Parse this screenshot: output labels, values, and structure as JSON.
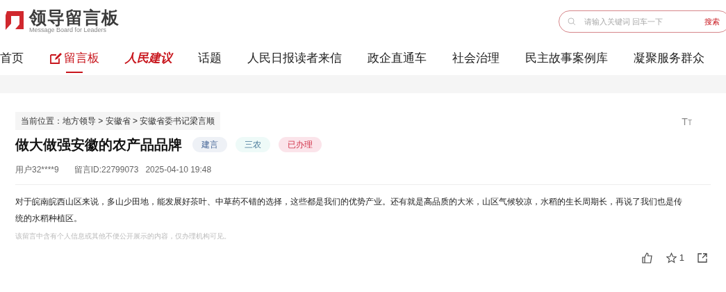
{
  "logo": {
    "title": "领导留言板",
    "subtitle": "Message Board for Leaders"
  },
  "search": {
    "placeholder": "请输入关键词 回车一下",
    "button": "搜索"
  },
  "nav": [
    {
      "label": "首页",
      "kind": "plain",
      "selected": false
    },
    {
      "label": "留言板",
      "kind": "icon",
      "selected": true
    },
    {
      "label": "人民建议",
      "kind": "script",
      "selected": false
    },
    {
      "label": "话题",
      "kind": "plain",
      "selected": false
    },
    {
      "label": "人民日报读者来信",
      "kind": "plain",
      "selected": false
    },
    {
      "label": "政企直通车",
      "kind": "plain",
      "selected": false
    },
    {
      "label": "社会治理",
      "kind": "plain",
      "selected": false
    },
    {
      "label": "民主故事案例库",
      "kind": "plain",
      "selected": false
    },
    {
      "label": "凝聚服务群众",
      "kind": "plain",
      "selected": false
    }
  ],
  "breadcrumb": "当前位置：地方领导 > 安徽省 > 安徽省委书记梁言顺",
  "title": "做大做强安徽的农产品品牌",
  "tags": [
    {
      "label": "建言",
      "color": "#eef1f6"
    },
    {
      "label": "三农",
      "color": "#eefaf8"
    },
    {
      "label": "已办理",
      "color": "#fbe4ea"
    }
  ],
  "meta": {
    "user": "用户32****9",
    "message_id": "留言ID:22799073",
    "time": "2025-04-10 19:48"
  },
  "body": "对于皖南皖西山区来说，多山少田地，能发展好茶叶、中草药不错的选择，这些都是我们的优势产业。还有就是高品质的大米，山区气候较凉，水稻的生长周期长，再说了我们也是传统的水稻种植区。",
  "notice": "该留言中含有个人信息或其他不便公开展示的内容，仅办理机构可见。",
  "actions": {
    "favorites": "1"
  },
  "font_size_button": "TT"
}
